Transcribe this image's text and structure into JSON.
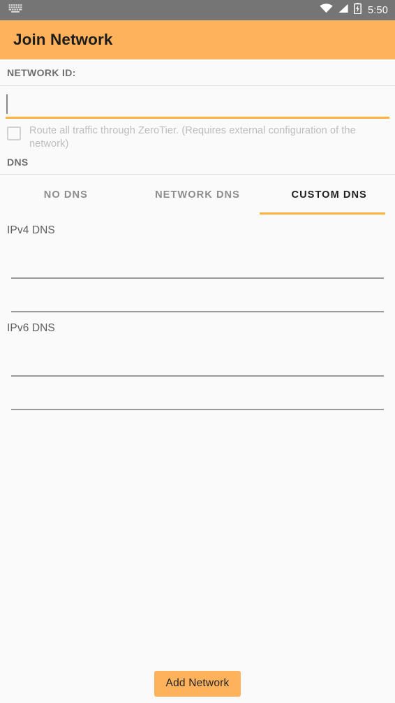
{
  "statusbar": {
    "keyboard_icon": "keyboard-icon",
    "wifi_icon": "wifi-icon",
    "signal_icon": "cell-signal-icon",
    "battery_icon": "battery-charging-icon",
    "time": "5:50",
    "background": "#757575",
    "foreground": "#FFFFFF"
  },
  "actionbar": {
    "title": "Join Network",
    "background": "#FFB25C",
    "title_color": "#1C1C1C"
  },
  "form": {
    "network_id_label": "NETWORK ID:",
    "network_id_value": "",
    "network_id_placeholder": "",
    "network_id_underline_color": "#FFB142",
    "route_all_traffic": {
      "line1": "Route all traffic through ZeroTier. (Requires external configuration of the",
      "line2": "network)",
      "checked": false,
      "enabled": false
    },
    "dns_label": "DNS"
  },
  "tabs": {
    "items": [
      {
        "label": "NO DNS",
        "selected": false
      },
      {
        "label": "NETWORK DNS",
        "selected": false
      },
      {
        "label": "CUSTOM DNS",
        "selected": true
      }
    ],
    "indicator_color": "#FFB142"
  },
  "dns": {
    "ipv4_label": "IPv4 DNS",
    "ipv4_values": [
      "",
      ""
    ],
    "ipv6_label": "IPv6 DNS",
    "ipv6_values": [
      "",
      ""
    ]
  },
  "footer": {
    "add_network_label": "Add Network",
    "button_color": "#FFB25C",
    "button_text_color": "#232323"
  }
}
